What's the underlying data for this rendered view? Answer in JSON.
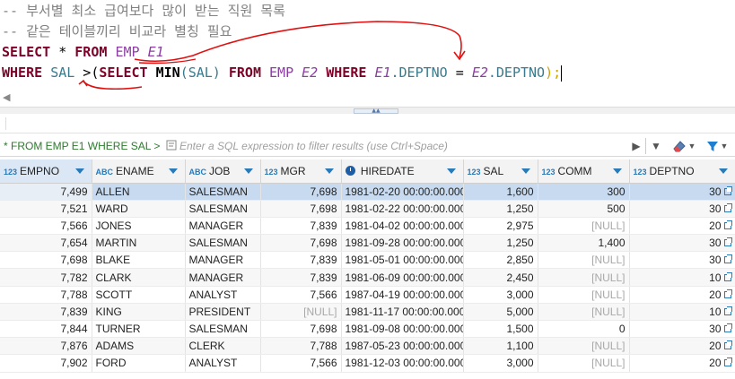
{
  "editor": {
    "comment1": "-- 부서별 최소 급여보다 많이 받는 직원 목록",
    "comment2": "-- 같은 테이블끼리 비교라 별칭 필요",
    "line3": {
      "kw_select": "SELECT",
      "star": " * ",
      "kw_from": "FROM",
      "table": "EMP",
      "alias": "E1"
    },
    "line4": {
      "kw_where": "WHERE",
      "col_sal": "SAL",
      "gt_paren": " >(",
      "kw_select": "SELECT",
      "fn_min": "MIN",
      "min_arg": "(SAL)",
      "kw_from": "FROM",
      "table": "EMP",
      "alias_e2": "E2",
      "kw_where2": "WHERE",
      "alias_e1": "E1",
      "dot_deptno1": ".DEPTNO",
      "eq": " = ",
      "alias_e2b": "E2",
      "dot_deptno2": ".DEPTNO",
      "close": ");"
    }
  },
  "filterbar": {
    "query_text": "* FROM EMP E1 WHERE SAL >",
    "placeholder": "Enter a SQL expression to filter results (use Ctrl+Space)"
  },
  "colors": {
    "keyword": "#7f0028",
    "identifier": "#3a7a8c",
    "table": "#8a3fa0",
    "annotation": "#e01010",
    "selected_row": "#c7daf0"
  },
  "grid": {
    "columns": [
      {
        "type": "123",
        "name": "EMPNO"
      },
      {
        "type": "ABC",
        "name": "ENAME"
      },
      {
        "type": "ABC",
        "name": "JOB"
      },
      {
        "type": "123",
        "name": "MGR"
      },
      {
        "type": "clock-icon",
        "name": "HIREDATE"
      },
      {
        "type": "123",
        "name": "SAL"
      },
      {
        "type": "123",
        "name": "COMM"
      },
      {
        "type": "123",
        "name": "DEPTNO"
      }
    ],
    "rows": [
      [
        "7,499",
        "ALLEN",
        "SALESMAN",
        "7,698",
        "1981-02-20 00:00:00.000",
        "1,600",
        "300",
        "30"
      ],
      [
        "7,521",
        "WARD",
        "SALESMAN",
        "7,698",
        "1981-02-22 00:00:00.000",
        "1,250",
        "500",
        "30"
      ],
      [
        "7,566",
        "JONES",
        "MANAGER",
        "7,839",
        "1981-04-02 00:00:00.000",
        "2,975",
        "[NULL]",
        "20"
      ],
      [
        "7,654",
        "MARTIN",
        "SALESMAN",
        "7,698",
        "1981-09-28 00:00:00.000",
        "1,250",
        "1,400",
        "30"
      ],
      [
        "7,698",
        "BLAKE",
        "MANAGER",
        "7,839",
        "1981-05-01 00:00:00.000",
        "2,850",
        "[NULL]",
        "30"
      ],
      [
        "7,782",
        "CLARK",
        "MANAGER",
        "7,839",
        "1981-06-09 00:00:00.000",
        "2,450",
        "[NULL]",
        "10"
      ],
      [
        "7,788",
        "SCOTT",
        "ANALYST",
        "7,566",
        "1987-04-19 00:00:00.000",
        "3,000",
        "[NULL]",
        "20"
      ],
      [
        "7,839",
        "KING",
        "PRESIDENT",
        "[NULL]",
        "1981-11-17 00:00:00.000",
        "5,000",
        "[NULL]",
        "10"
      ],
      [
        "7,844",
        "TURNER",
        "SALESMAN",
        "7,698",
        "1981-09-08 00:00:00.000",
        "1,500",
        "0",
        "30"
      ],
      [
        "7,876",
        "ADAMS",
        "CLERK",
        "7,788",
        "1987-05-23 00:00:00.000",
        "1,100",
        "[NULL]",
        "20"
      ],
      [
        "7,902",
        "FORD",
        "ANALYST",
        "7,566",
        "1981-12-03 00:00:00.000",
        "3,000",
        "[NULL]",
        "20"
      ]
    ]
  }
}
